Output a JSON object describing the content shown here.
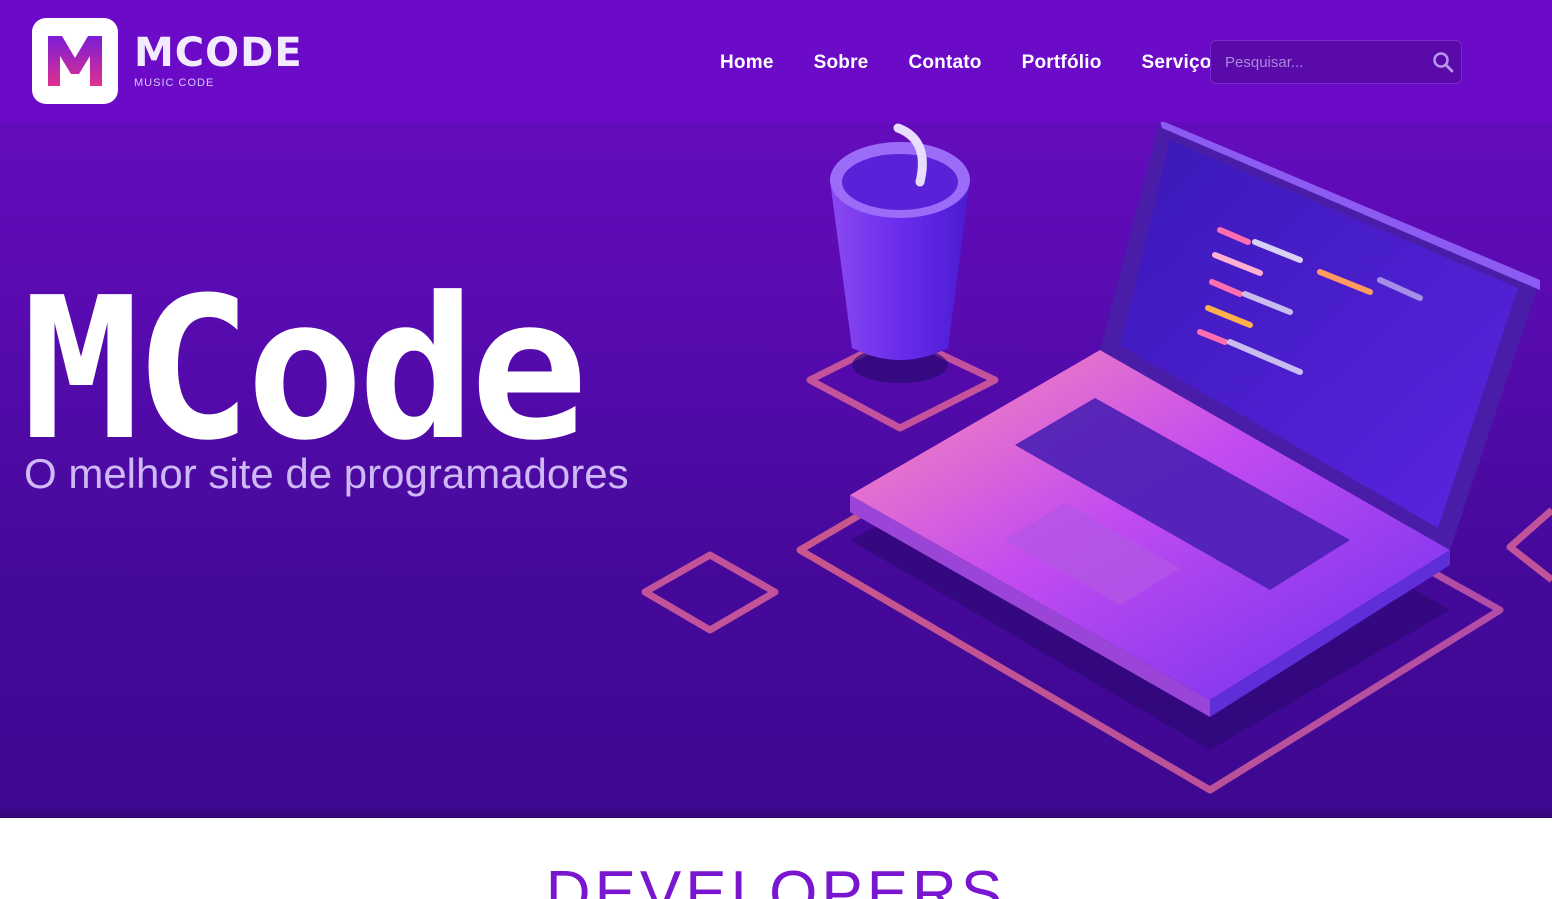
{
  "brand": {
    "logo_letter": "M",
    "logo_word": "MCODE",
    "logo_tagline": "MUSIC CODE"
  },
  "nav": {
    "items": [
      {
        "label": "Home"
      },
      {
        "label": "Sobre"
      },
      {
        "label": "Contato"
      },
      {
        "label": "Portfólio"
      },
      {
        "label": "Serviços"
      }
    ]
  },
  "search": {
    "placeholder": "Pesquisar..."
  },
  "hero": {
    "title": "MCode",
    "subtitle": "O melhor site de programadores"
  },
  "section": {
    "heading": "DEVELOPERS"
  },
  "colors": {
    "primary": "#6b0bc7",
    "hero_dark": "#3d0890",
    "accent": "#d66aff",
    "heading": "#7a16cf"
  },
  "icons": {
    "search": "search-icon",
    "illustration": "laptop-code-illustration"
  }
}
